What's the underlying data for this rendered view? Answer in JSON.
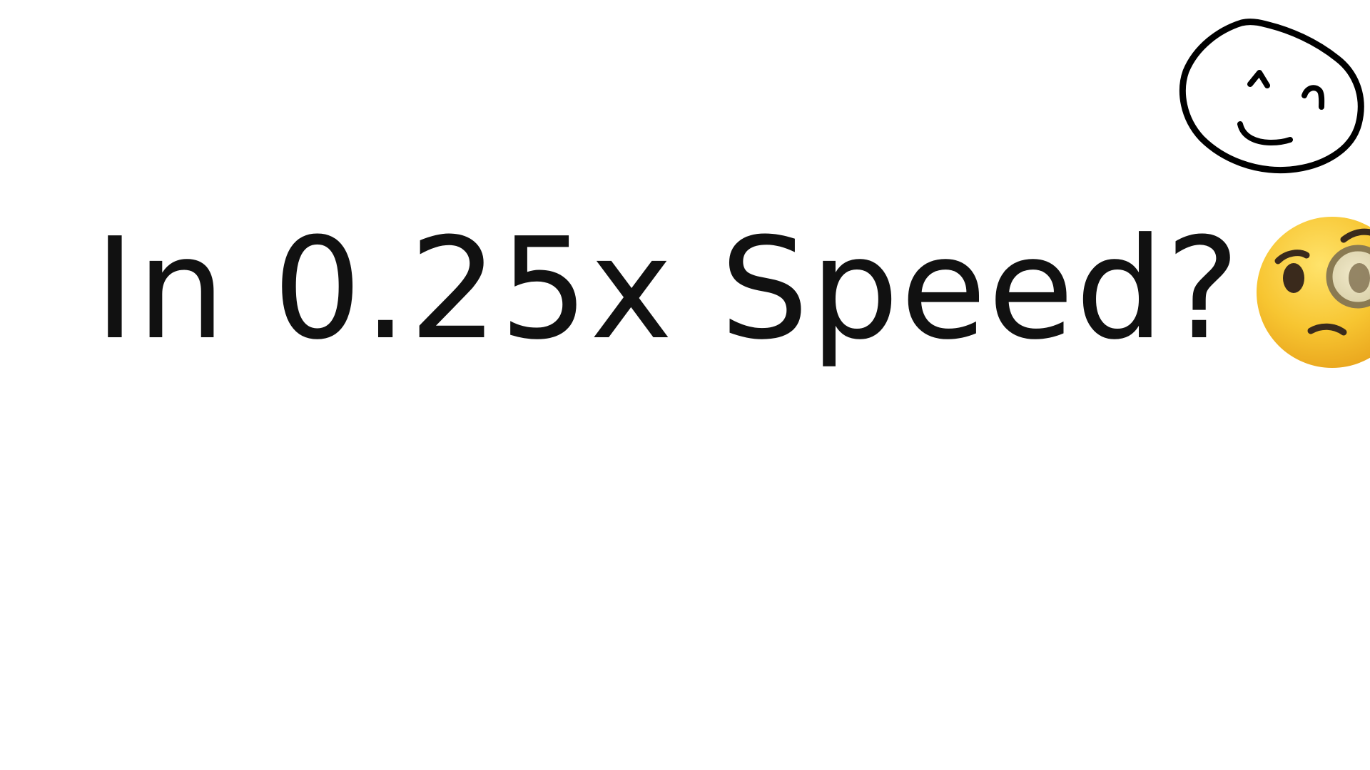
{
  "caption": {
    "text": "In 0.25x Speed?"
  },
  "icons": {
    "emoji": "face-with-monocle-icon",
    "doodle": "hand-drawn-smiley-face-icon"
  },
  "colors": {
    "background": "#ffffff",
    "text": "#111111",
    "emoji_face": "#f7c531",
    "doodle_stroke": "#000000"
  }
}
